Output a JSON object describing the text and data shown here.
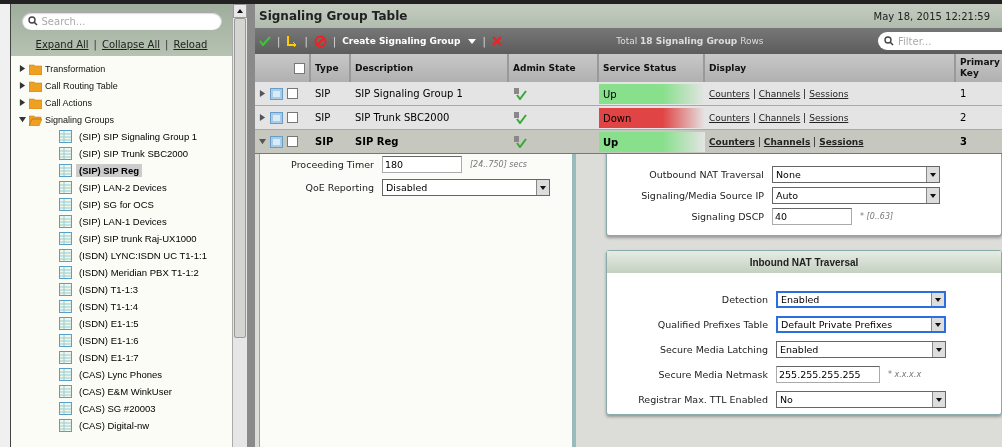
{
  "sidebar": {
    "search": {
      "placeholder": "Search..."
    },
    "links": [
      "Expand All",
      "Collapse All",
      "Reload"
    ],
    "link_separators": [
      "|",
      "|"
    ],
    "tree": [
      {
        "label": "Transformation",
        "expanded": false
      },
      {
        "label": "Call Routing Table",
        "expanded": false
      },
      {
        "label": "Call Actions",
        "expanded": false
      },
      {
        "label": "Signaling Groups",
        "expanded": true,
        "children": [
          {
            "label": "(SIP) SIP Signaling Group 1",
            "selected": false
          },
          {
            "label": "(SIP) SIP Trunk SBC2000",
            "selected": false
          },
          {
            "label": "(SIP) SIP Reg",
            "selected": true
          },
          {
            "label": "(SIP) LAN-2 Devices",
            "selected": false
          },
          {
            "label": "(SIP) SG for OCS",
            "selected": false
          },
          {
            "label": "(SIP) LAN-1 Devices",
            "selected": false
          },
          {
            "label": "(SIP) SIP trunk Raj-UX1000",
            "selected": false
          },
          {
            "label": "(ISDN) LYNC:ISDN UC T1-1:1",
            "selected": false
          },
          {
            "label": "(ISDN) Meridian PBX T1-1:2",
            "selected": false
          },
          {
            "label": "(ISDN) T1-1:3",
            "selected": false
          },
          {
            "label": "(ISDN) T1-1:4",
            "selected": false
          },
          {
            "label": "(ISDN) E1-1:5",
            "selected": false
          },
          {
            "label": "(ISDN) E1-1:6",
            "selected": false
          },
          {
            "label": "(ISDN) E1-1:7",
            "selected": false
          },
          {
            "label": "(CAS) Lync Phones",
            "selected": false
          },
          {
            "label": "(CAS) E&M WinkUser",
            "selected": false
          },
          {
            "label": "(CAS) SG #20003",
            "selected": false
          },
          {
            "label": "(CAS) Digital-nw",
            "selected": false
          }
        ]
      }
    ]
  },
  "main": {
    "title": "Signaling Group Table",
    "datetime": "May 18, 2015 12:21:59",
    "toolbar": {
      "separators": [
        "|",
        "|",
        "|",
        "|"
      ],
      "create": "Create Signaling Group",
      "total": "Total **18 Signaling Group** Rows",
      "filter": {
        "placeholder": "Filter..."
      }
    },
    "table": {
      "columns": [
        "Type",
        "Description",
        "Admin State",
        "Service Status",
        "Display",
        "Primary Key"
      ],
      "all_checked": false,
      "rows": [
        {
          "expanded": false,
          "checked": false,
          "type": "SIP",
          "description": "SIP Signaling Group 1",
          "status": {
            "text": "Up",
            "kind": "up"
          },
          "links": [
            "Counters",
            "Channels",
            "Sessions"
          ],
          "key": "1"
        },
        {
          "expanded": false,
          "checked": false,
          "type": "SIP",
          "description": "SIP Trunk SBC2000",
          "status": {
            "text": "Down",
            "kind": "down"
          },
          "links": [
            "Counters",
            "Channels",
            "Sessions"
          ],
          "key": "2"
        },
        {
          "expanded": true,
          "checked": false,
          "type": "SIP",
          "description": "SIP Reg",
          "status": {
            "text": "Up",
            "kind": "up"
          },
          "links": [
            "Counters",
            "Channels",
            "Sessions"
          ],
          "key": "3"
        }
      ]
    },
    "detail": {
      "left_fields": [
        {
          "kind": "text",
          "label": "Proceeding Timer",
          "value": "180",
          "hint": "[24..750] secs"
        },
        {
          "kind": "select",
          "label": "QoE Reporting",
          "value": "Disabled",
          "highlighted": false
        }
      ],
      "right_fields": [
        {
          "kind": "select",
          "label": "Outbound NAT Traversal",
          "value": "None",
          "highlighted": false
        },
        {
          "kind": "select",
          "label": "Signaling/Media Source IP",
          "value": "Auto",
          "highlighted": false
        },
        {
          "kind": "text",
          "label": "Signaling DSCP",
          "value": "40",
          "hint": "* [0..63]"
        }
      ],
      "inbound": {
        "title": "Inbound NAT Traversal",
        "fields": [
          {
            "kind": "select",
            "label": "Detection",
            "value": "Enabled",
            "highlighted": true
          },
          {
            "kind": "select",
            "label": "Qualified Prefixes Table",
            "value": "Default Private Prefixes",
            "highlighted": true
          },
          {
            "kind": "select",
            "label": "Secure Media Latching",
            "value": "Enabled",
            "highlighted": false
          },
          {
            "kind": "text",
            "label": "Secure Media Netmask",
            "value": "255.255.255.255",
            "hint": "* x.x.x.x"
          },
          {
            "kind": "select",
            "label": "Registrar Max. TTL Enabled",
            "value": "No",
            "highlighted": false
          }
        ]
      }
    }
  }
}
